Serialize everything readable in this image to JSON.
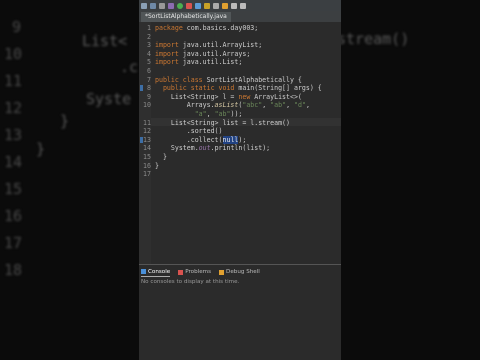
{
  "background": {
    "left_lines": [
      "List<",
      ".c",
      "Syste",
      "}",
      "}"
    ],
    "left_numbers": [
      "9",
      "10",
      "11",
      "12",
      "13",
      "14",
      "15",
      "16",
      "17",
      "18"
    ],
    "right_lines": [
      "stream()"
    ]
  },
  "editor": {
    "tab_label": "*SortListAlphabetically.java",
    "lines": [
      {
        "num": "1",
        "segments": [
          {
            "t": "package",
            "c": "kw"
          },
          {
            "t": " com.basics.day003;",
            "c": "cls"
          }
        ]
      },
      {
        "num": "2",
        "segments": []
      },
      {
        "num": "3",
        "segments": [
          {
            "t": "import",
            "c": "kw"
          },
          {
            "t": " java.util.ArrayList;",
            "c": "cls"
          }
        ]
      },
      {
        "num": "4",
        "segments": [
          {
            "t": "import",
            "c": "kw"
          },
          {
            "t": " java.util.Arrays;",
            "c": "cls"
          }
        ]
      },
      {
        "num": "5",
        "segments": [
          {
            "t": "import",
            "c": "kw"
          },
          {
            "t": " java.util.List;",
            "c": "cls"
          }
        ]
      },
      {
        "num": "6",
        "segments": []
      },
      {
        "num": "7",
        "segments": [
          {
            "t": "public class",
            "c": "kw"
          },
          {
            "t": " SortListAlphabetically {",
            "c": "cls"
          }
        ]
      },
      {
        "num": "8",
        "segments": [
          {
            "t": "  public static void",
            "c": "kw"
          },
          {
            "t": " main(String[] args) {",
            "c": "cls"
          }
        ]
      },
      {
        "num": "9",
        "segments": [
          {
            "t": "    List<String> l = ",
            "c": "cls"
          },
          {
            "t": "new",
            "c": "kw"
          },
          {
            "t": " ArrayList<>(",
            "c": "cls"
          }
        ]
      },
      {
        "num": "10",
        "segments": [
          {
            "t": "        Arrays.",
            "c": "cls"
          },
          {
            "t": "asList",
            "c": "ital"
          },
          {
            "t": "(",
            "c": "cls"
          },
          {
            "t": "\"abc\"",
            "c": "str"
          },
          {
            "t": ", ",
            "c": "cls"
          },
          {
            "t": "\"ab\"",
            "c": "str"
          },
          {
            "t": ", ",
            "c": "cls"
          },
          {
            "t": "\"d\"",
            "c": "str"
          },
          {
            "t": ",",
            "c": "cls"
          }
        ]
      },
      {
        "num": "",
        "segments": [
          {
            "t": "          ",
            "c": "cls"
          },
          {
            "t": "\"a\"",
            "c": "str"
          },
          {
            "t": ", ",
            "c": "cls"
          },
          {
            "t": "\"ab\"",
            "c": "str"
          },
          {
            "t": "));",
            "c": "cls"
          }
        ]
      },
      {
        "num": "11",
        "segments": [
          {
            "t": "    List<String> list = l.stream()",
            "c": "cls"
          }
        ]
      },
      {
        "num": "12",
        "segments": [
          {
            "t": "        .sorted()",
            "c": "cls"
          }
        ]
      },
      {
        "num": "13",
        "segments": [
          {
            "t": "        .collect(",
            "c": "cls"
          },
          {
            "t": "null",
            "c": "hl"
          },
          {
            "t": ");",
            "c": "cls"
          }
        ]
      },
      {
        "num": "14",
        "segments": [
          {
            "t": "    System.",
            "c": "cls"
          },
          {
            "t": "out",
            "c": "field"
          },
          {
            "t": ".println(list);",
            "c": "cls"
          }
        ]
      },
      {
        "num": "15",
        "segments": [
          {
            "t": "  }",
            "c": "cls"
          }
        ]
      },
      {
        "num": "16",
        "segments": [
          {
            "t": "}",
            "c": "cls"
          }
        ]
      },
      {
        "num": "17",
        "segments": []
      }
    ]
  },
  "console": {
    "tabs": [
      {
        "label": "Console",
        "active": true,
        "icon": "console-icon"
      },
      {
        "label": "Problems",
        "active": false,
        "icon": "problems-icon"
      },
      {
        "label": "Debug Shell",
        "active": false,
        "icon": "debug-shell-icon"
      }
    ],
    "message": "No consoles to display at this time."
  }
}
